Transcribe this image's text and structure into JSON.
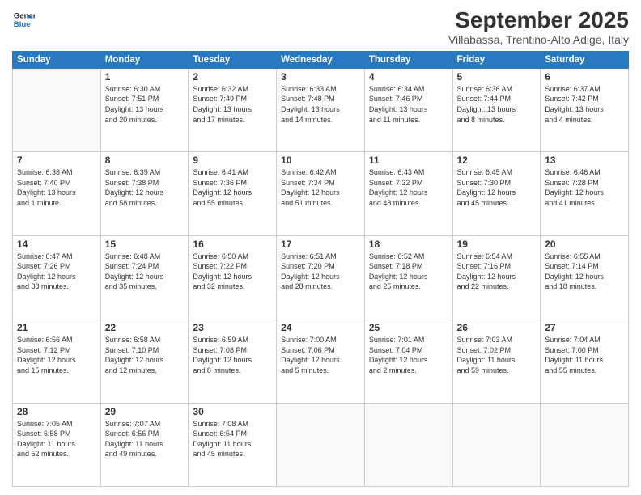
{
  "header": {
    "logo_line1": "General",
    "logo_line2": "Blue",
    "month_title": "September 2025",
    "location": "Villabassa, Trentino-Alto Adige, Italy"
  },
  "days_of_week": [
    "Sunday",
    "Monday",
    "Tuesday",
    "Wednesday",
    "Thursday",
    "Friday",
    "Saturday"
  ],
  "weeks": [
    [
      {
        "day": "",
        "info": ""
      },
      {
        "day": "1",
        "info": "Sunrise: 6:30 AM\nSunset: 7:51 PM\nDaylight: 13 hours\nand 20 minutes."
      },
      {
        "day": "2",
        "info": "Sunrise: 6:32 AM\nSunset: 7:49 PM\nDaylight: 13 hours\nand 17 minutes."
      },
      {
        "day": "3",
        "info": "Sunrise: 6:33 AM\nSunset: 7:48 PM\nDaylight: 13 hours\nand 14 minutes."
      },
      {
        "day": "4",
        "info": "Sunrise: 6:34 AM\nSunset: 7:46 PM\nDaylight: 13 hours\nand 11 minutes."
      },
      {
        "day": "5",
        "info": "Sunrise: 6:36 AM\nSunset: 7:44 PM\nDaylight: 13 hours\nand 8 minutes."
      },
      {
        "day": "6",
        "info": "Sunrise: 6:37 AM\nSunset: 7:42 PM\nDaylight: 13 hours\nand 4 minutes."
      }
    ],
    [
      {
        "day": "7",
        "info": "Sunrise: 6:38 AM\nSunset: 7:40 PM\nDaylight: 13 hours\nand 1 minute."
      },
      {
        "day": "8",
        "info": "Sunrise: 6:39 AM\nSunset: 7:38 PM\nDaylight: 12 hours\nand 58 minutes."
      },
      {
        "day": "9",
        "info": "Sunrise: 6:41 AM\nSunset: 7:36 PM\nDaylight: 12 hours\nand 55 minutes."
      },
      {
        "day": "10",
        "info": "Sunrise: 6:42 AM\nSunset: 7:34 PM\nDaylight: 12 hours\nand 51 minutes."
      },
      {
        "day": "11",
        "info": "Sunrise: 6:43 AM\nSunset: 7:32 PM\nDaylight: 12 hours\nand 48 minutes."
      },
      {
        "day": "12",
        "info": "Sunrise: 6:45 AM\nSunset: 7:30 PM\nDaylight: 12 hours\nand 45 minutes."
      },
      {
        "day": "13",
        "info": "Sunrise: 6:46 AM\nSunset: 7:28 PM\nDaylight: 12 hours\nand 41 minutes."
      }
    ],
    [
      {
        "day": "14",
        "info": "Sunrise: 6:47 AM\nSunset: 7:26 PM\nDaylight: 12 hours\nand 38 minutes."
      },
      {
        "day": "15",
        "info": "Sunrise: 6:48 AM\nSunset: 7:24 PM\nDaylight: 12 hours\nand 35 minutes."
      },
      {
        "day": "16",
        "info": "Sunrise: 6:50 AM\nSunset: 7:22 PM\nDaylight: 12 hours\nand 32 minutes."
      },
      {
        "day": "17",
        "info": "Sunrise: 6:51 AM\nSunset: 7:20 PM\nDaylight: 12 hours\nand 28 minutes."
      },
      {
        "day": "18",
        "info": "Sunrise: 6:52 AM\nSunset: 7:18 PM\nDaylight: 12 hours\nand 25 minutes."
      },
      {
        "day": "19",
        "info": "Sunrise: 6:54 AM\nSunset: 7:16 PM\nDaylight: 12 hours\nand 22 minutes."
      },
      {
        "day": "20",
        "info": "Sunrise: 6:55 AM\nSunset: 7:14 PM\nDaylight: 12 hours\nand 18 minutes."
      }
    ],
    [
      {
        "day": "21",
        "info": "Sunrise: 6:56 AM\nSunset: 7:12 PM\nDaylight: 12 hours\nand 15 minutes."
      },
      {
        "day": "22",
        "info": "Sunrise: 6:58 AM\nSunset: 7:10 PM\nDaylight: 12 hours\nand 12 minutes."
      },
      {
        "day": "23",
        "info": "Sunrise: 6:59 AM\nSunset: 7:08 PM\nDaylight: 12 hours\nand 8 minutes."
      },
      {
        "day": "24",
        "info": "Sunrise: 7:00 AM\nSunset: 7:06 PM\nDaylight: 12 hours\nand 5 minutes."
      },
      {
        "day": "25",
        "info": "Sunrise: 7:01 AM\nSunset: 7:04 PM\nDaylight: 12 hours\nand 2 minutes."
      },
      {
        "day": "26",
        "info": "Sunrise: 7:03 AM\nSunset: 7:02 PM\nDaylight: 11 hours\nand 59 minutes."
      },
      {
        "day": "27",
        "info": "Sunrise: 7:04 AM\nSunset: 7:00 PM\nDaylight: 11 hours\nand 55 minutes."
      }
    ],
    [
      {
        "day": "28",
        "info": "Sunrise: 7:05 AM\nSunset: 6:58 PM\nDaylight: 11 hours\nand 52 minutes."
      },
      {
        "day": "29",
        "info": "Sunrise: 7:07 AM\nSunset: 6:56 PM\nDaylight: 11 hours\nand 49 minutes."
      },
      {
        "day": "30",
        "info": "Sunrise: 7:08 AM\nSunset: 6:54 PM\nDaylight: 11 hours\nand 45 minutes."
      },
      {
        "day": "",
        "info": ""
      },
      {
        "day": "",
        "info": ""
      },
      {
        "day": "",
        "info": ""
      },
      {
        "day": "",
        "info": ""
      }
    ]
  ]
}
